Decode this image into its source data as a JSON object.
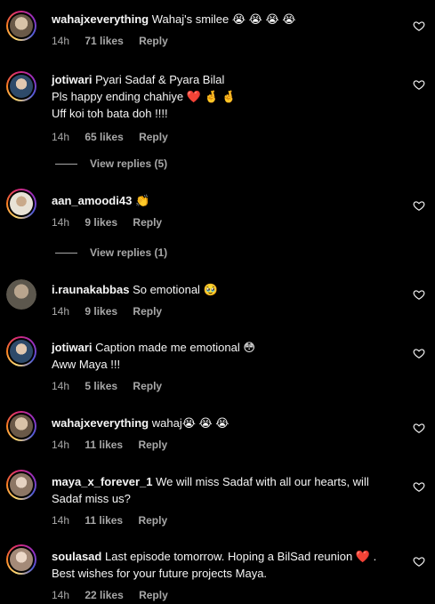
{
  "comments": [
    {
      "username": "wahajxeverything",
      "text": "Wahaj's smilee 😭 😭 😭 😭",
      "lines": [],
      "time": "14h",
      "likes": "71 likes",
      "reply": "Reply",
      "avatar_color": "#7a6a58",
      "has_story_ring": true
    },
    {
      "username": "jotiwari",
      "text": "Pyari Sadaf & Pyara Bilal",
      "lines": [
        "Pls happy ending chahiye ❤️ 🤞 🤞",
        "Uff koi toh bata doh !!!!"
      ],
      "time": "14h",
      "likes": "65 likes",
      "reply": "Reply",
      "view_replies": "View replies (5)",
      "avatar_color": "#3b5a7a",
      "has_story_ring": true
    },
    {
      "username": "aan_amoodi43",
      "text": "👏",
      "lines": [],
      "time": "14h",
      "likes": "9 likes",
      "reply": "Reply",
      "view_replies": "View replies (1)",
      "avatar_color": "#c9b99a",
      "has_story_ring": true
    },
    {
      "username": "i.raunakabbas",
      "text": "So emotional 🥹",
      "lines": [],
      "time": "14h",
      "likes": "9 likes",
      "reply": "Reply",
      "avatar_color": "#6b6559",
      "has_story_ring": false
    },
    {
      "username": "jotiwari",
      "text": "Caption made me emotional 😳",
      "lines": [
        "Aww Maya !!!"
      ],
      "time": "14h",
      "likes": "5 likes",
      "reply": "Reply",
      "avatar_color": "#3b5a7a",
      "has_story_ring": true
    },
    {
      "username": "wahajxeverything",
      "text": "wahaj😭 😭 😭",
      "lines": [],
      "time": "14h",
      "likes": "11 likes",
      "reply": "Reply",
      "avatar_color": "#7a6a58",
      "has_story_ring": true
    },
    {
      "username": "maya_x_forever_1",
      "text": "We will miss Sadaf with all our hearts, will",
      "lines": [
        "Sadaf miss us?"
      ],
      "time": "14h",
      "likes": "11 likes",
      "reply": "Reply",
      "avatar_color": "#b89a86",
      "has_story_ring": true
    },
    {
      "username": "soulasad",
      "text": "Last episode tomorrow. Hoping a BilSad reunion ❤️ .",
      "lines": [
        "Best wishes for your future projects Maya."
      ],
      "time": "14h",
      "likes": "22 likes",
      "reply": "Reply",
      "avatar_color": "#c8b2a3",
      "has_story_ring": true
    }
  ],
  "icons": {
    "like": "heart-outline-icon"
  },
  "colors": {
    "background": "#000000",
    "primary_text": "#f5f5f5",
    "secondary_text": "#a8a8a8",
    "heart_red": "#ff3040"
  }
}
